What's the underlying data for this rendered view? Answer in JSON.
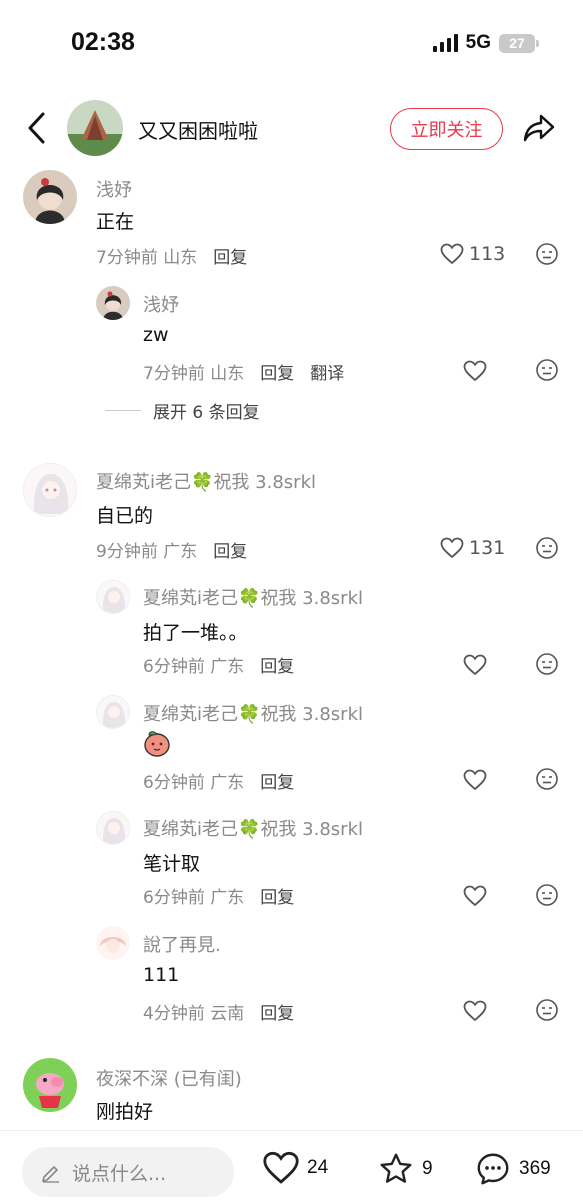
{
  "status": {
    "time": "02:38",
    "network": "5G",
    "battery": "27"
  },
  "header": {
    "name": "又又困困啦啦",
    "follow_label": "立即关注"
  },
  "comments": [
    {
      "name": "浅妤",
      "text": "正在",
      "time": "7分钟前",
      "location": "山东",
      "reply_label": "回复",
      "likes": "113",
      "replies": [
        {
          "name": "浅妤",
          "text": "zw",
          "time": "7分钟前",
          "location": "山东",
          "reply_label": "回复",
          "translate_label": "翻译"
        }
      ],
      "expand_label": "展开 6 条回复"
    },
    {
      "name": "夏绵芄i老己",
      "suffix": "祝我 3.8srkl",
      "text": "自已的",
      "time": "9分钟前",
      "location": "广东",
      "reply_label": "回复",
      "likes": "131",
      "replies": [
        {
          "name": "夏绵芄i老己",
          "suffix": "祝我 3.8srkl",
          "text": "拍了一堆。。",
          "time": "6分钟前",
          "location": "广东",
          "reply_label": "回复"
        },
        {
          "name": "夏绵芄i老己",
          "suffix": "祝我 3.8srkl",
          "text": "",
          "emoji": "peach-sticker",
          "time": "6分钟前",
          "location": "广东",
          "reply_label": "回复"
        },
        {
          "name": "夏绵芄i老己",
          "suffix": "祝我 3.8srkl",
          "text": "笔计取",
          "time": "6分钟前",
          "location": "广东",
          "reply_label": "回复"
        },
        {
          "name": "說了再見.",
          "text": "111",
          "time": "4分钟前",
          "location": "云南",
          "reply_label": "回复"
        }
      ]
    },
    {
      "name": "夜深不深 (已有闺)",
      "text": "刚拍好"
    }
  ],
  "bottom": {
    "placeholder": "说点什么...",
    "likes": "24",
    "favorites": "9",
    "comments": "369"
  },
  "colors": {
    "accent": "#e8394d",
    "clover": "#3db85a"
  }
}
